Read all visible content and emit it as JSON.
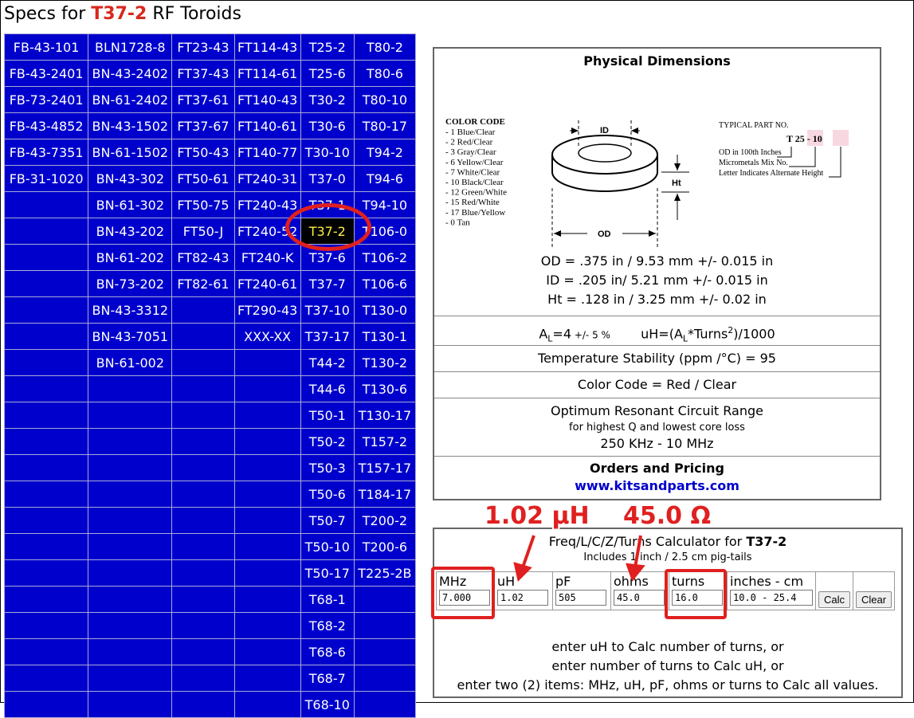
{
  "header": {
    "prefix": "Specs for ",
    "part": "T37-2",
    "suffix": " RF Toroids"
  },
  "parts_grid": [
    [
      "FB-43-101",
      "BLN1728-8",
      "FT23-43",
      "FT114-43",
      "T25-2",
      "T80-2"
    ],
    [
      "FB-43-2401",
      "BN-43-2402",
      "FT37-43",
      "FT114-61",
      "T25-6",
      "T80-6"
    ],
    [
      "FB-73-2401",
      "BN-61-2402",
      "FT37-61",
      "FT140-43",
      "T30-2",
      "T80-10"
    ],
    [
      "FB-43-4852",
      "BN-43-1502",
      "FT37-67",
      "FT140-61",
      "T30-6",
      "T80-17"
    ],
    [
      "FB-43-7351",
      "BN-61-1502",
      "FT50-43",
      "FT140-77",
      "T30-10",
      "T94-2"
    ],
    [
      "FB-31-1020",
      "BN-43-302",
      "FT50-61",
      "FT240-31",
      "T37-0",
      "T94-6"
    ],
    [
      "",
      "BN-61-302",
      "FT50-75",
      "FT240-43",
      "T37-1",
      "T94-10"
    ],
    [
      "",
      "BN-43-202",
      "FT50-J",
      "FT240-52",
      "T37-2",
      "T106-0"
    ],
    [
      "",
      "BN-61-202",
      "FT82-43",
      "FT240-K",
      "T37-6",
      "T106-2"
    ],
    [
      "",
      "BN-73-202",
      "FT82-61",
      "FT240-61",
      "T37-7",
      "T106-6"
    ],
    [
      "",
      "BN-43-3312",
      "",
      "FT290-43",
      "T37-10",
      "T130-0"
    ],
    [
      "",
      "BN-43-7051",
      "",
      "XXX-XX",
      "T37-17",
      "T130-1"
    ],
    [
      "",
      "BN-61-002",
      "",
      "",
      "T44-2",
      "T130-2"
    ],
    [
      "",
      "",
      "",
      "",
      "T44-6",
      "T130-6"
    ],
    [
      "",
      "",
      "",
      "",
      "T50-1",
      "T130-17"
    ],
    [
      "",
      "",
      "",
      "",
      "T50-2",
      "T157-2"
    ],
    [
      "",
      "",
      "",
      "",
      "T50-3",
      "T157-17"
    ],
    [
      "",
      "",
      "",
      "",
      "T50-6",
      "T184-17"
    ],
    [
      "",
      "",
      "",
      "",
      "T50-7",
      "T200-2"
    ],
    [
      "",
      "",
      "",
      "",
      "T50-10",
      "T200-6"
    ],
    [
      "",
      "",
      "",
      "",
      "T50-17",
      "T225-2B"
    ],
    [
      "",
      "",
      "",
      "",
      "T68-1",
      ""
    ],
    [
      "",
      "",
      "",
      "",
      "T68-2",
      ""
    ],
    [
      "",
      "",
      "",
      "",
      "T68-6",
      ""
    ],
    [
      "",
      "",
      "",
      "",
      "T68-7",
      ""
    ],
    [
      "",
      "",
      "",
      "",
      "T68-10",
      ""
    ]
  ],
  "selected_part": "T37-2",
  "dimensions": {
    "heading": "Physical Dimensions",
    "color_code_title": "COLOR CODE",
    "color_codes": [
      "- 1  Blue/Clear",
      "- 2  Red/Clear",
      "- 3  Gray/Clear",
      "- 6  Yellow/Clear",
      "- 7  White/Clear",
      "- 10 Black/Clear",
      "- 12 Green/White",
      "- 15 Red/White",
      "- 17 Blue/Yellow",
      "- 0  Tan"
    ],
    "label_id": "ID",
    "label_od": "OD",
    "label_ht": "Ht",
    "typical_title": "TYPICAL PART NO.",
    "typical_part": "T 25 - 10",
    "typical_notes": [
      "OD in 100th Inches",
      "Micrometals Mix No.",
      "Letter Indicates Alternate Height"
    ],
    "od": "OD = .375 in / 9.53 mm +/- 0.015 in",
    "id": "ID = .205 in/ 5.21 mm +/- 0.015 in",
    "ht": "Ht = .128 in / 3.25 mm +/- 0.02 in"
  },
  "al": {
    "prefix": "A",
    "sub": "L",
    "value": "=4",
    "tol": " +/- 5 %",
    "formula_a": "uH=(A",
    "formula_sub": "L",
    "formula_b": "*Turns",
    "formula_sup": "2",
    "formula_c": ")/1000"
  },
  "temperature": "Temperature Stability (ppm /°C) = 95",
  "color_code": "Color Code = Red / Clear",
  "resonant": {
    "title": "Optimum Resonant Circuit Range",
    "sub": "for highest Q and lowest core loss",
    "range": "250 KHz - 10 MHz"
  },
  "orders": {
    "title": "Orders and Pricing",
    "link": "www.kitsandparts.com"
  },
  "calculator": {
    "title_prefix": "Freq/L/C/Z/Turns Calculator for ",
    "title_part": "T37-2",
    "subtitle": "Includes 1 inch / 2.5 cm pig-tails",
    "fields": [
      {
        "label": "MHz",
        "value": "7.000"
      },
      {
        "label": "uH",
        "value": "1.02"
      },
      {
        "label": "pF",
        "value": "505"
      },
      {
        "label": "ohms",
        "value": "45.0"
      },
      {
        "label": "turns",
        "value": "16.0"
      },
      {
        "label": "inches - cm",
        "value": "10.0 - 25.4"
      }
    ],
    "calc_label": "Calc",
    "clear_label": "Clear",
    "notes": [
      "enter uH to Calc number of turns, or",
      "enter number of turns to Calc uH, or",
      "enter two (2) items: MHz, uH, pF, ohms or turns to Calc all values."
    ]
  },
  "annotations": {
    "uh_callout": "1.02 μH",
    "ohm_callout": "45.0 Ω"
  },
  "colors": {
    "grid_bg": "#0000cc",
    "accent_red": "#e02020",
    "link_blue": "#0000cc"
  }
}
